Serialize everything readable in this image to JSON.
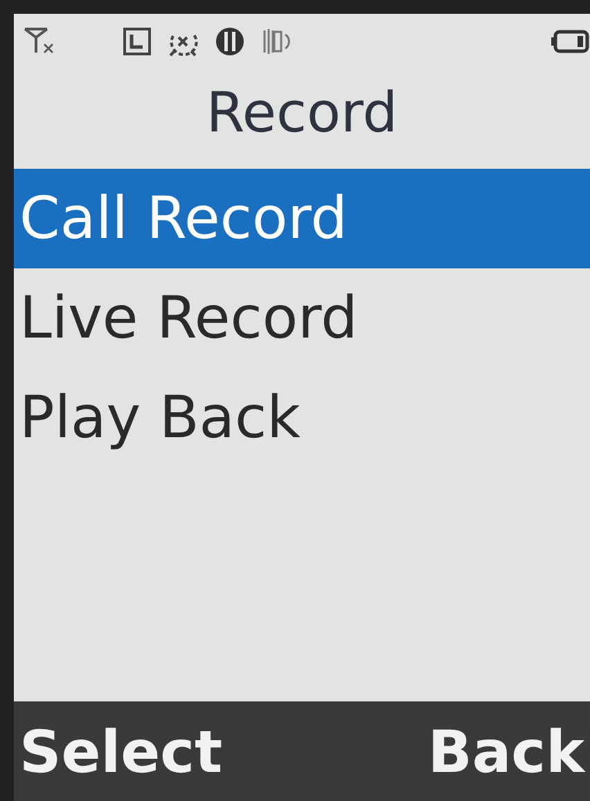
{
  "title": "Record",
  "menu": [
    {
      "label": "Call Record",
      "selected": true
    },
    {
      "label": "Live Record",
      "selected": false
    },
    {
      "label": "Play Back",
      "selected": false
    }
  ],
  "softkeys": {
    "left": "Select",
    "right": "Back"
  }
}
